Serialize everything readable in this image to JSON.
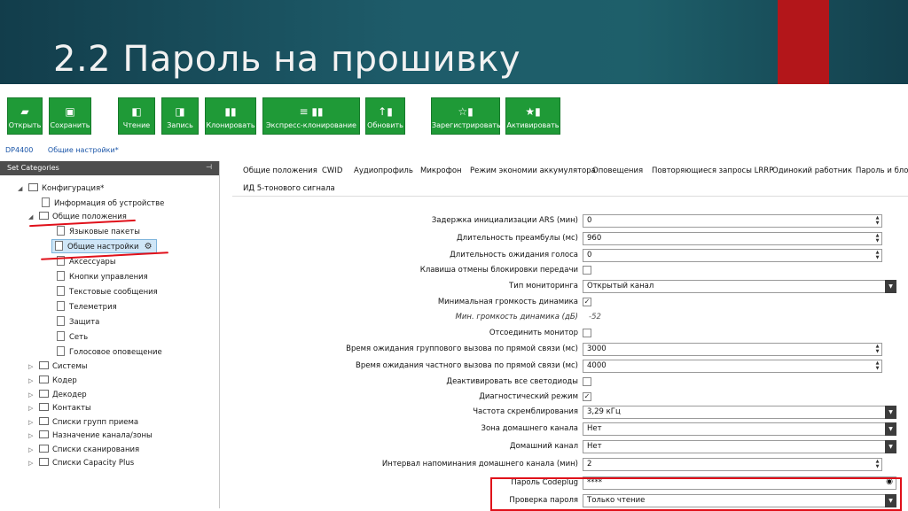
{
  "slide_title": "2.2 Пароль на прошивку",
  "toolbar": {
    "buttons": [
      {
        "label": "Открыть",
        "icon": "folder-icon"
      },
      {
        "label": "Сохранить",
        "icon": "save-icon"
      },
      {
        "label": "Чтение",
        "icon": "read-icon"
      },
      {
        "label": "Запись",
        "icon": "write-icon"
      },
      {
        "label": "Клонировать",
        "icon": "clone-icon"
      },
      {
        "label": "Экспресс-клонирование",
        "icon": "express-clone-icon"
      },
      {
        "label": "Обновить",
        "icon": "update-icon"
      },
      {
        "label": "Зарегистрировать",
        "icon": "register-icon"
      },
      {
        "label": "Активировать",
        "icon": "activate-icon"
      }
    ],
    "accent": "#1f9a37"
  },
  "breadcrumb": {
    "device": "DP4400",
    "page": "Общие настройки*"
  },
  "tree": {
    "header": "Set Categories",
    "items": [
      "Конфигурация*",
      "Информация об устройстве",
      "Общие положения",
      "Языковые пакеты",
      "Общие настройки",
      "Аксессуары",
      "Кнопки управления",
      "Текстовые сообщения",
      "Телеметрия",
      "Защита",
      "Сеть",
      "Голосовое оповещение",
      "Системы",
      "Кодер",
      "Декодер",
      "Контакты",
      "Списки групп приема",
      "Назначение канала/зоны",
      "Списки сканирования",
      "Списки Capacity Plus"
    ]
  },
  "tabs": [
    "Общие положения",
    "CWID",
    "Аудиопрофиль",
    "Микрофон",
    "Режим экономии аккумулятора",
    "Оповещения",
    "Повторяющиеся запросы LRRP",
    "Одинокий работник",
    "Пароль и блоки",
    "ИД 5-тонового сигнала"
  ],
  "settings": [
    {
      "label": "Задержка инициализации ARS (мин)",
      "type": "number",
      "value": "0"
    },
    {
      "label": "Длительность преамбулы (мс)",
      "type": "number",
      "value": "960"
    },
    {
      "label": "Длительность ожидания голоса",
      "type": "number",
      "value": "0"
    },
    {
      "label": "Клавиша отмены блокировки передачи",
      "type": "checkbox",
      "value": ""
    },
    {
      "label": "Тип мониторинга",
      "type": "select",
      "value": "Открытый канал"
    },
    {
      "label": "Минимальная громкость динамика",
      "type": "checkbox",
      "value": "✓"
    },
    {
      "label": "Мин. громкость динамика (дБ)",
      "type": "readonly",
      "value": "-52"
    },
    {
      "label": "Отсоединить монитор",
      "type": "checkbox",
      "value": ""
    },
    {
      "label": "Время ожидания группового вызова по прямой связи (мс)",
      "type": "number",
      "value": "3000"
    },
    {
      "label": "Время ожидания частного вызова по прямой связи (мс)",
      "type": "number",
      "value": "4000"
    },
    {
      "label": "Деактивировать все светодиоды",
      "type": "checkbox",
      "value": ""
    },
    {
      "label": "Диагностический режим",
      "type": "checkbox",
      "value": "✓"
    },
    {
      "label": "Частота скремблирования",
      "type": "select",
      "value": "3,29 кГц"
    },
    {
      "label": "Зона домашнего канала",
      "type": "select",
      "value": "Нет"
    },
    {
      "label": "Домашний канал",
      "type": "select",
      "value": "Нет"
    },
    {
      "label": "Интервал напоминания домашнего канала (мин)",
      "type": "number",
      "value": "2"
    },
    {
      "label": "Пароль Codeplug",
      "type": "password",
      "value": "****"
    },
    {
      "label": "Проверка пароля",
      "type": "select",
      "value": "Только чтение"
    }
  ]
}
